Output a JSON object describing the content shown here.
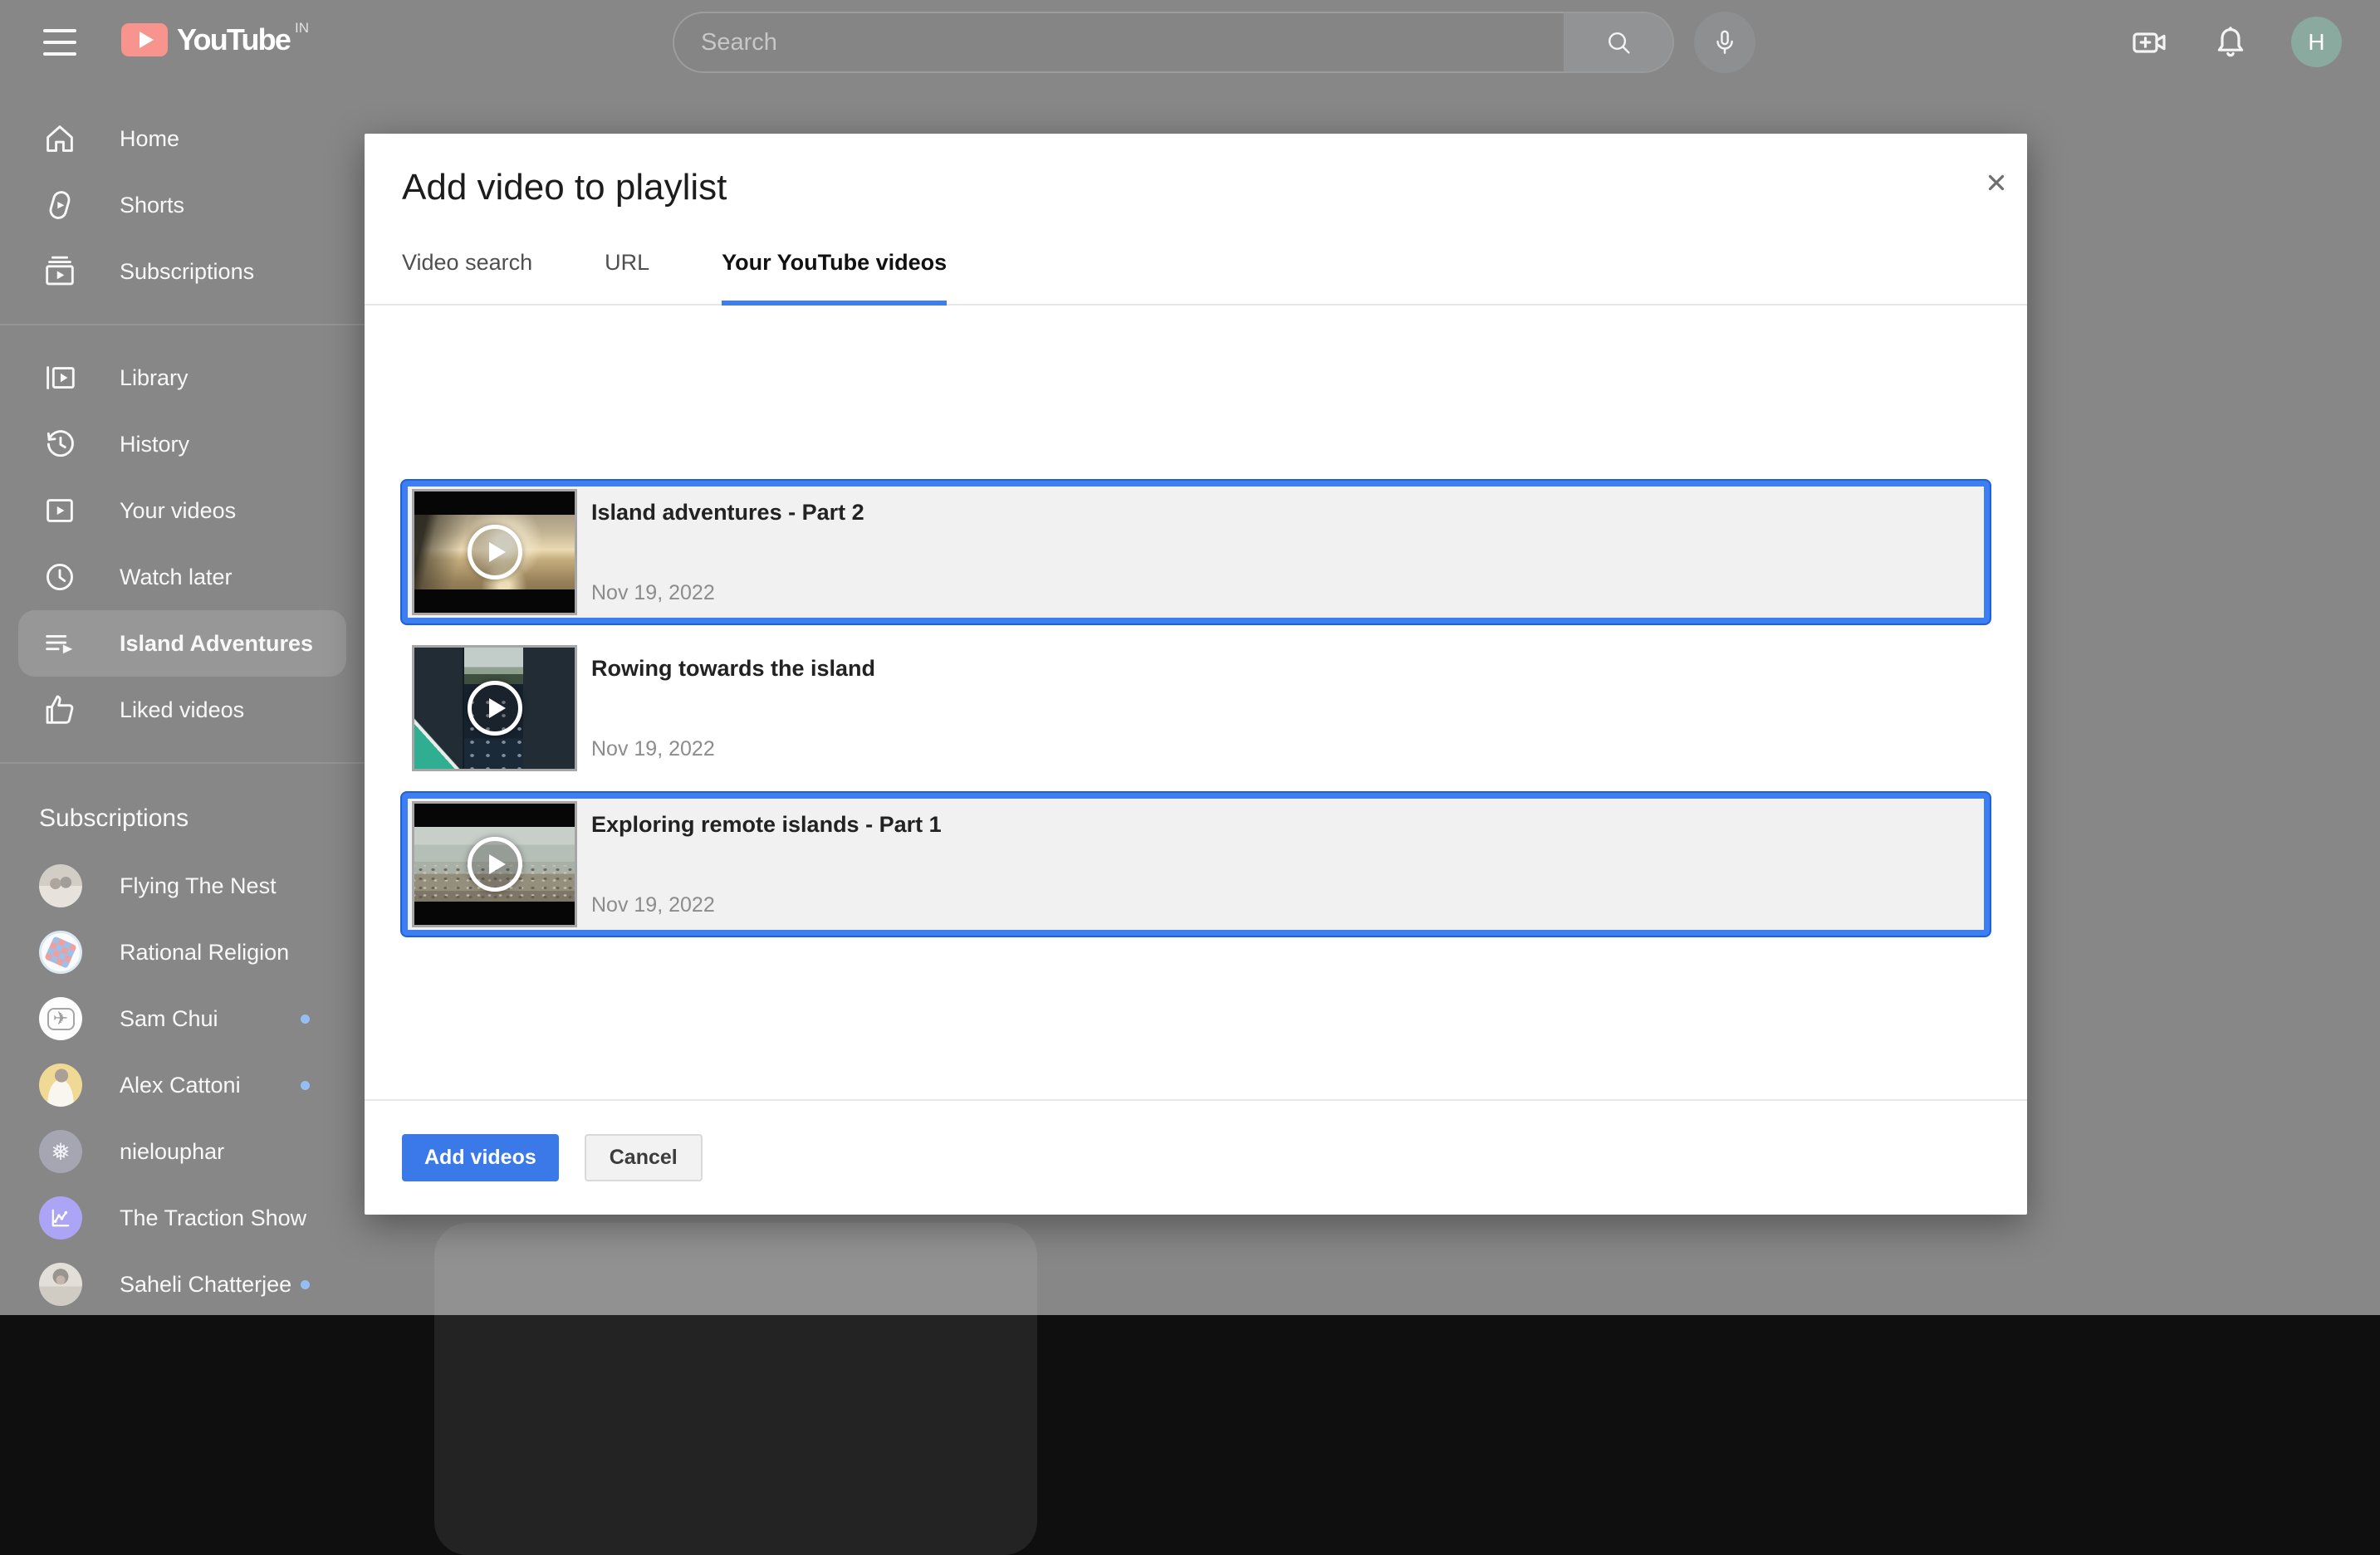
{
  "topbar": {
    "logo_text": "YouTube",
    "logo_country": "IN",
    "search_placeholder": "Search",
    "search_value": "",
    "avatar_letter": "H"
  },
  "sidebar": {
    "primary": [
      {
        "label": "Home",
        "icon": "home-icon"
      },
      {
        "label": "Shorts",
        "icon": "shorts-icon"
      },
      {
        "label": "Subscriptions",
        "icon": "subscriptions-icon"
      }
    ],
    "secondary": [
      {
        "label": "Library",
        "icon": "library-icon"
      },
      {
        "label": "History",
        "icon": "history-icon"
      },
      {
        "label": "Your videos",
        "icon": "your-videos-icon"
      },
      {
        "label": "Watch later",
        "icon": "watch-later-icon"
      },
      {
        "label": "Island Adventures",
        "icon": "playlist-icon",
        "active": true
      },
      {
        "label": "Liked videos",
        "icon": "liked-videos-icon"
      }
    ],
    "subscriptions_header": "Subscriptions",
    "channels": [
      {
        "name": "Flying The Nest",
        "avatar": "flying-the-nest",
        "new_content": false
      },
      {
        "name": "Rational Religion",
        "avatar": "rational-religion",
        "new_content": false
      },
      {
        "name": "Sam Chui",
        "avatar": "sam-chui",
        "new_content": true
      },
      {
        "name": "Alex Cattoni",
        "avatar": "alex-cattoni",
        "new_content": true
      },
      {
        "name": "nielouphar",
        "avatar": "nielouphar",
        "new_content": false
      },
      {
        "name": "The Traction Show",
        "avatar": "traction-show",
        "new_content": false
      },
      {
        "name": "Saheli Chatterjee",
        "avatar": "saheli-chatterjee",
        "new_content": true
      }
    ]
  },
  "modal": {
    "title": "Add video to playlist",
    "tabs": [
      {
        "label": "Video search",
        "active": false
      },
      {
        "label": "URL",
        "active": false
      },
      {
        "label": "Your YouTube videos",
        "active": true
      }
    ],
    "videos": [
      {
        "title": "Island adventures - Part 2",
        "date": "Nov 19, 2022",
        "selected": true,
        "thumb": "sunset"
      },
      {
        "title": "Rowing towards the island",
        "date": "Nov 19, 2022",
        "selected": false,
        "thumb": "kayak"
      },
      {
        "title": "Exploring remote islands - Part 1",
        "date": "Nov 19, 2022",
        "selected": true,
        "thumb": "shore"
      }
    ],
    "footer": {
      "add_label": "Add videos",
      "cancel_label": "Cancel"
    }
  },
  "colors": {
    "accent_blue": "#3b78e8",
    "selection_border": "#3d7ef2",
    "tab_underline": "#3e7fe8",
    "logo_red": "#ef291c",
    "scrim": "rgba(255,255,255,0.5)",
    "new_content_dot": "#2d7de8"
  }
}
